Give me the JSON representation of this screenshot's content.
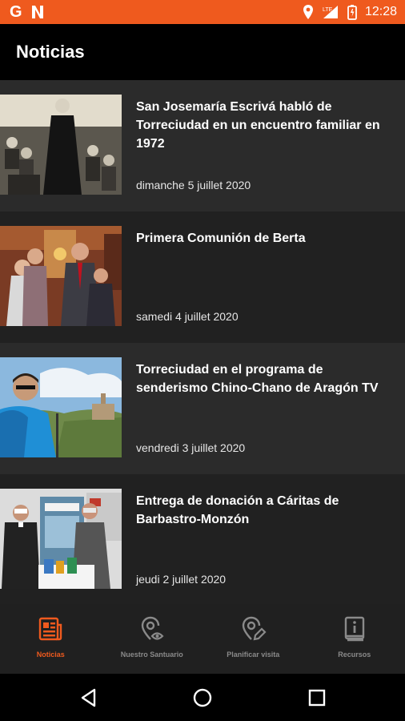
{
  "status_bar": {
    "time": "12:28",
    "lte": "LTE"
  },
  "app_bar": {
    "title": "Noticias"
  },
  "news": [
    {
      "title": "San Josemaría Escrivá habló de Torreciudad en un encuentro familiar en 1972",
      "date": "dimanche 5 juillet 2020"
    },
    {
      "title": "Primera Comunión de Berta",
      "date": "samedi 4 juillet 2020"
    },
    {
      "title": "Torreciudad en el programa de senderismo Chino-Chano de Aragón TV",
      "date": "vendredi 3 juillet 2020"
    },
    {
      "title": "Entrega de donación a Cáritas de Barbastro-Monzón",
      "date": "jeudi 2 juillet 2020"
    }
  ],
  "bottom_nav": {
    "items": [
      {
        "label": "Noticias",
        "icon": "newspaper-icon",
        "active": true
      },
      {
        "label": "Nuestro Santuario",
        "icon": "location-eye-icon",
        "active": false
      },
      {
        "label": "Planificar visita",
        "icon": "location-edit-icon",
        "active": false
      },
      {
        "label": "Recursos",
        "icon": "info-book-icon",
        "active": false
      }
    ]
  },
  "colors": {
    "accent": "#ef5a1e",
    "item_bg_a": "#2b2b2b",
    "item_bg_b": "#212121",
    "nav_bg": "#202020"
  }
}
